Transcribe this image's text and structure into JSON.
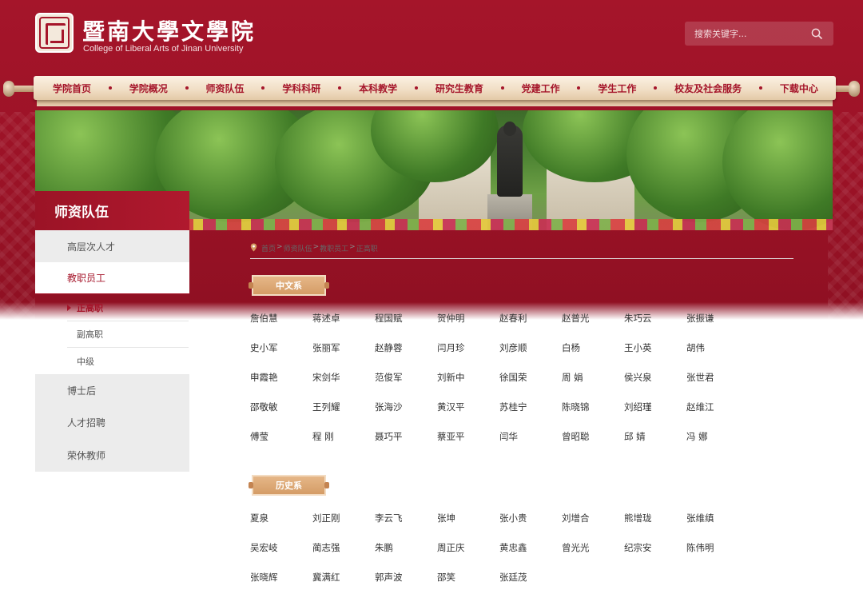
{
  "header": {
    "title_cn": "暨南大學文學院",
    "title_en": "College of Liberal Arts of Jinan University",
    "search_placeholder": "搜索关键字..."
  },
  "nav": {
    "items": [
      "学院首页",
      "学院概况",
      "师资队伍",
      "学科科研",
      "本科教学",
      "研究生教育",
      "党建工作",
      "学生工作",
      "校友及社会服务",
      "下载中心"
    ]
  },
  "sidebar": {
    "title": "师资队伍",
    "items": [
      {
        "label": "高层次人才"
      },
      {
        "label": "教职员工"
      },
      {
        "label": "博士后"
      },
      {
        "label": "人才招聘"
      },
      {
        "label": "荣休教师"
      }
    ],
    "subitems": [
      {
        "label": "正高职"
      },
      {
        "label": "副高职"
      },
      {
        "label": "中级"
      }
    ]
  },
  "breadcrumb": [
    "首页",
    "师资队伍",
    "教职员工",
    "正高职"
  ],
  "departments": [
    {
      "name": "中文系",
      "members": [
        "詹伯慧",
        "蒋述卓",
        "程国赋",
        "贺仲明",
        "赵春利",
        "赵普光",
        "朱巧云",
        "张振谦",
        "史小军",
        "张丽军",
        "赵静蓉",
        "闫月珍",
        "刘彦顺",
        "白杨",
        "王小英",
        "胡伟",
        "申霞艳",
        "宋剑华",
        "范俊军",
        "刘新中",
        "徐国荣",
        "周 娟",
        "侯兴泉",
        "张世君",
        "邵敬敏",
        "王列耀",
        "张海沙",
        "黄汉平",
        "苏桂宁",
        "陈晓锦",
        "刘绍瑾",
        "赵维江",
        "傅莹",
        "程 刚",
        "聂巧平",
        "蔡亚平",
        "闫华",
        "曾昭聪",
        "邱 婧",
        "冯 娜"
      ]
    },
    {
      "name": "历史系",
      "members": [
        "夏泉",
        "刘正刚",
        "李云飞",
        "张坤",
        "张小贵",
        "刘增合",
        "熊增珑",
        "张维缜",
        "吴宏岐",
        "蔺志强",
        "朱鹏",
        "周正庆",
        "黄忠鑫",
        "曾光光",
        "纪宗安",
        "陈伟明",
        "张晓辉",
        "冀满红",
        "郭声波",
        "邵笑",
        "张廷茂"
      ]
    }
  ],
  "colors": {
    "brand_red": "#a5152a",
    "nav_gold": "#f1dfc6",
    "tag_orange": "#d39a63"
  }
}
